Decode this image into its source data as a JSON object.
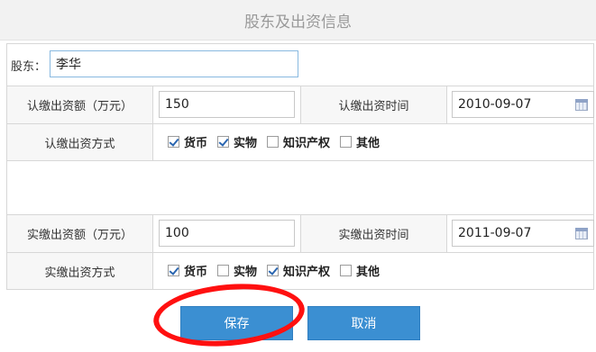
{
  "page_title": "股东及出资信息",
  "shareholder": {
    "label": "股东：",
    "value": "李华"
  },
  "subscribed": {
    "amount_label": "认缴出资额（万元）",
    "amount_value": "150",
    "time_label": "认缴出资时间",
    "time_value": "2010-09-07",
    "method_label": "认缴出资方式",
    "methods": [
      {
        "label": "货币",
        "checked": true
      },
      {
        "label": "实物",
        "checked": true
      },
      {
        "label": "知识产权",
        "checked": false
      },
      {
        "label": "其他",
        "checked": false
      }
    ]
  },
  "paid": {
    "amount_label": "实缴出资额（万元）",
    "amount_value": "100",
    "time_label": "实缴出资时间",
    "time_value": "2011-09-07",
    "method_label": "实缴出资方式",
    "methods": [
      {
        "label": "货币",
        "checked": true
      },
      {
        "label": "实物",
        "checked": false
      },
      {
        "label": "知识产权",
        "checked": true
      },
      {
        "label": "其他",
        "checked": false
      }
    ]
  },
  "buttons": {
    "save": "保存",
    "cancel": "取消"
  },
  "colors": {
    "button_blue": "#3b8fd2",
    "check_blue": "#2b66b0",
    "annotation_red": "#ff1010"
  },
  "icons": {
    "date_picker": "calendar-icon",
    "checked": "check-icon"
  }
}
